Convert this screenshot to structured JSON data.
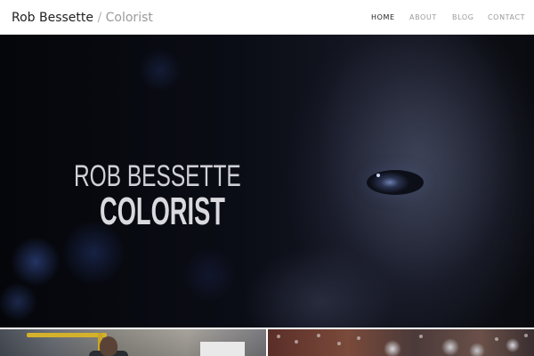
{
  "header": {
    "brand": {
      "name": "Rob Bessette",
      "separator": " / ",
      "role": "Colorist"
    },
    "nav": [
      {
        "label": "HOME",
        "active": true
      },
      {
        "label": "ABOUT",
        "active": false
      },
      {
        "label": "BLOG",
        "active": false
      },
      {
        "label": "CONTACT",
        "active": false
      }
    ]
  },
  "hero": {
    "title_line_1": "ROB BESSETTE",
    "title_line_2": "COLORIST"
  },
  "colors": {
    "text_dark": "#222222",
    "text_muted": "#9a9a9a",
    "hero_bg": "#0b0d16"
  }
}
